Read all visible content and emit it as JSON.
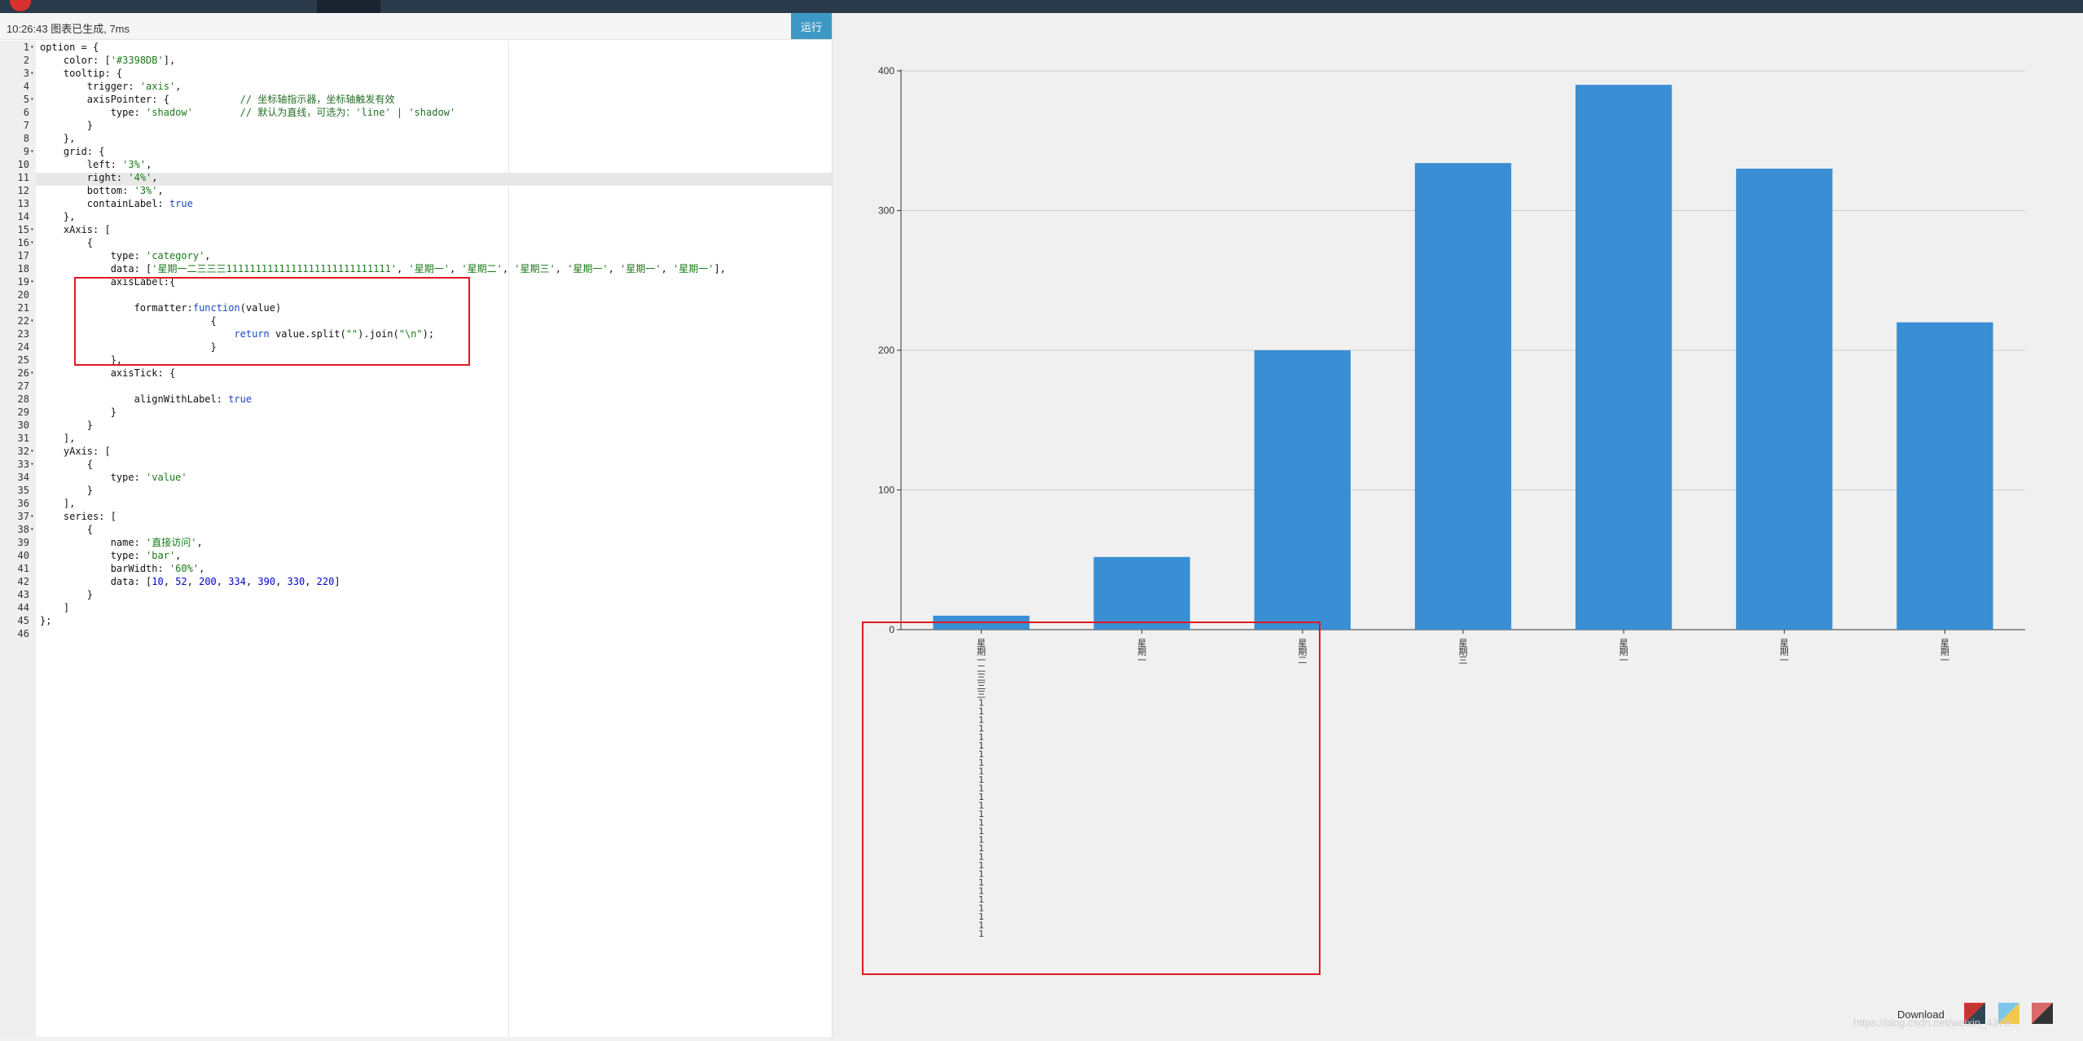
{
  "status": {
    "text": "10:26:43  图表已生成, 7ms",
    "run_label": "运行"
  },
  "code_lines": [
    "option = {",
    "    color: ['#3398DB'],",
    "    tooltip: {",
    "        trigger: 'axis',",
    "        axisPointer: {            // 坐标轴指示器，坐标轴触发有效",
    "            type: 'shadow'        // 默认为直线，可选为：'line' | 'shadow'",
    "        }",
    "    },",
    "    grid: {",
    "        left: '3%',",
    "        right: '4%',",
    "        bottom: '3%',",
    "        containLabel: true",
    "    },",
    "    xAxis: [",
    "        {",
    "            type: 'category',",
    "            data: ['星期一二三三三1111111111111111111111111111', '星期一', '星期二', '星期三', '星期一', '星期一', '星期一'],",
    "            axisLabel:{",
    "",
    "                formatter:function(value)",
    "                             {",
    "                                 return value.split(\"\").join(\"\\n\");",
    "                             }",
    "            },",
    "            axisTick: {",
    "",
    "                alignWithLabel: true",
    "            }",
    "        }",
    "    ],",
    "    yAxis: [",
    "        {",
    "            type: 'value'",
    "        }",
    "    ],",
    "    series: [",
    "        {",
    "            name: '直接访问',",
    "            type: 'bar',",
    "            barWidth: '60%',",
    "            data: [10, 52, 200, 334, 390, 330, 220]",
    "        }",
    "    ]",
    "};",
    ""
  ],
  "fold_lines": [
    1,
    3,
    5,
    9,
    15,
    16,
    19,
    22,
    26,
    32,
    33,
    37,
    38
  ],
  "chart_data": {
    "type": "bar",
    "categories": [
      "星期一二三三三1111111111111111111111111111",
      "星期一",
      "星期二",
      "星期三",
      "星期一",
      "星期一",
      "星期一"
    ],
    "values": [
      10,
      52,
      200,
      334,
      390,
      330,
      220
    ],
    "ylim": [
      0,
      400
    ],
    "yticks": [
      0,
      100,
      200,
      300,
      400
    ],
    "color": "#3a8ed4",
    "grid": true
  },
  "footer": {
    "download_label": "Download",
    "watermark": "https://blog.csdn.net/weixin_4379..."
  },
  "colors": {
    "highlight": "#e0191f",
    "bar": "#3a8ed4",
    "run": "#3e98c5"
  }
}
